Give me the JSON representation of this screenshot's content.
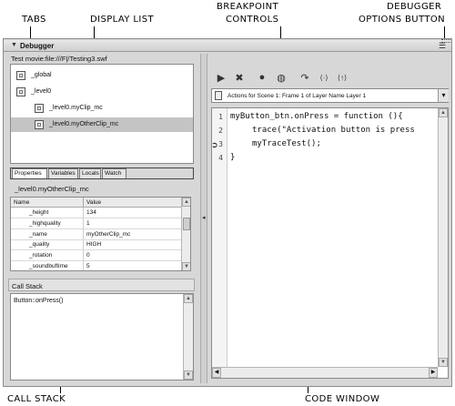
{
  "callouts": {
    "tabs": "TABS",
    "display_list": "DISPLAY LIST",
    "breakpoint_controls_1": "BREAKPOINT",
    "breakpoint_controls_2": "CONTROLS",
    "debugger_options_1": "DEBUGGER",
    "debugger_options_2": "OPTIONS BUTTON",
    "call_stack": "CALL STACK",
    "code_window": "CODE WINDOW"
  },
  "panel": {
    "title": "Debugger",
    "collapse_icon": "triangle-down-icon",
    "options_icon": "options-menu-icon"
  },
  "movie_path": "Test movie:file:///F|/Testing3.swf",
  "display_list": [
    {
      "label": "_global",
      "indent": 0,
      "selected": false
    },
    {
      "label": "_level0",
      "indent": 0,
      "selected": false
    },
    {
      "label": "_level0.myClip_mc",
      "indent": 1,
      "selected": false
    },
    {
      "label": "_level0.myOtherClip_mc",
      "indent": 1,
      "selected": true
    }
  ],
  "tabs": [
    "Properties",
    "Variables",
    "Locals",
    "Watch"
  ],
  "active_tab": "Properties",
  "selected_object": "_level0.myOtherClip_mc",
  "properties": {
    "headers": [
      "Name",
      "Value"
    ],
    "rows": [
      {
        "name": "_height",
        "value": "134"
      },
      {
        "name": "_highquality",
        "value": "1"
      },
      {
        "name": "_name",
        "value": "myOtherClip_mc"
      },
      {
        "name": "_quality",
        "value": "HIGH"
      },
      {
        "name": "_rotation",
        "value": "0"
      },
      {
        "name": "_soundbuftime",
        "value": "5"
      }
    ]
  },
  "call_stack": {
    "title": "Call Stack",
    "entries": [
      "Button::onPress()"
    ]
  },
  "toolbar": {
    "buttons": [
      "continue-icon",
      "stop-debugging-icon",
      "toggle-breakpoint-icon",
      "remove-all-breakpoints-icon",
      "step-over-icon",
      "step-in-icon",
      "step-out-icon"
    ]
  },
  "script_select": {
    "value": "Actions for Scene 1: Frame 1 of Layer Name Layer 1",
    "icon": "script-icon"
  },
  "code": {
    "lines": [
      {
        "num": "1",
        "text": "myButton_btn.onPress = function (){",
        "indent": 0,
        "breakpoint": false
      },
      {
        "num": "2",
        "text": "trace(\"Activation button is press",
        "indent": 1,
        "breakpoint": false
      },
      {
        "num": "3",
        "text": "myTraceTest();",
        "indent": 1,
        "breakpoint": true
      },
      {
        "num": "4",
        "text": "}",
        "indent": 0,
        "breakpoint": false
      }
    ]
  },
  "colors": {
    "selection": "#c4c4c4",
    "panel_bg": "#d7d7d7"
  }
}
